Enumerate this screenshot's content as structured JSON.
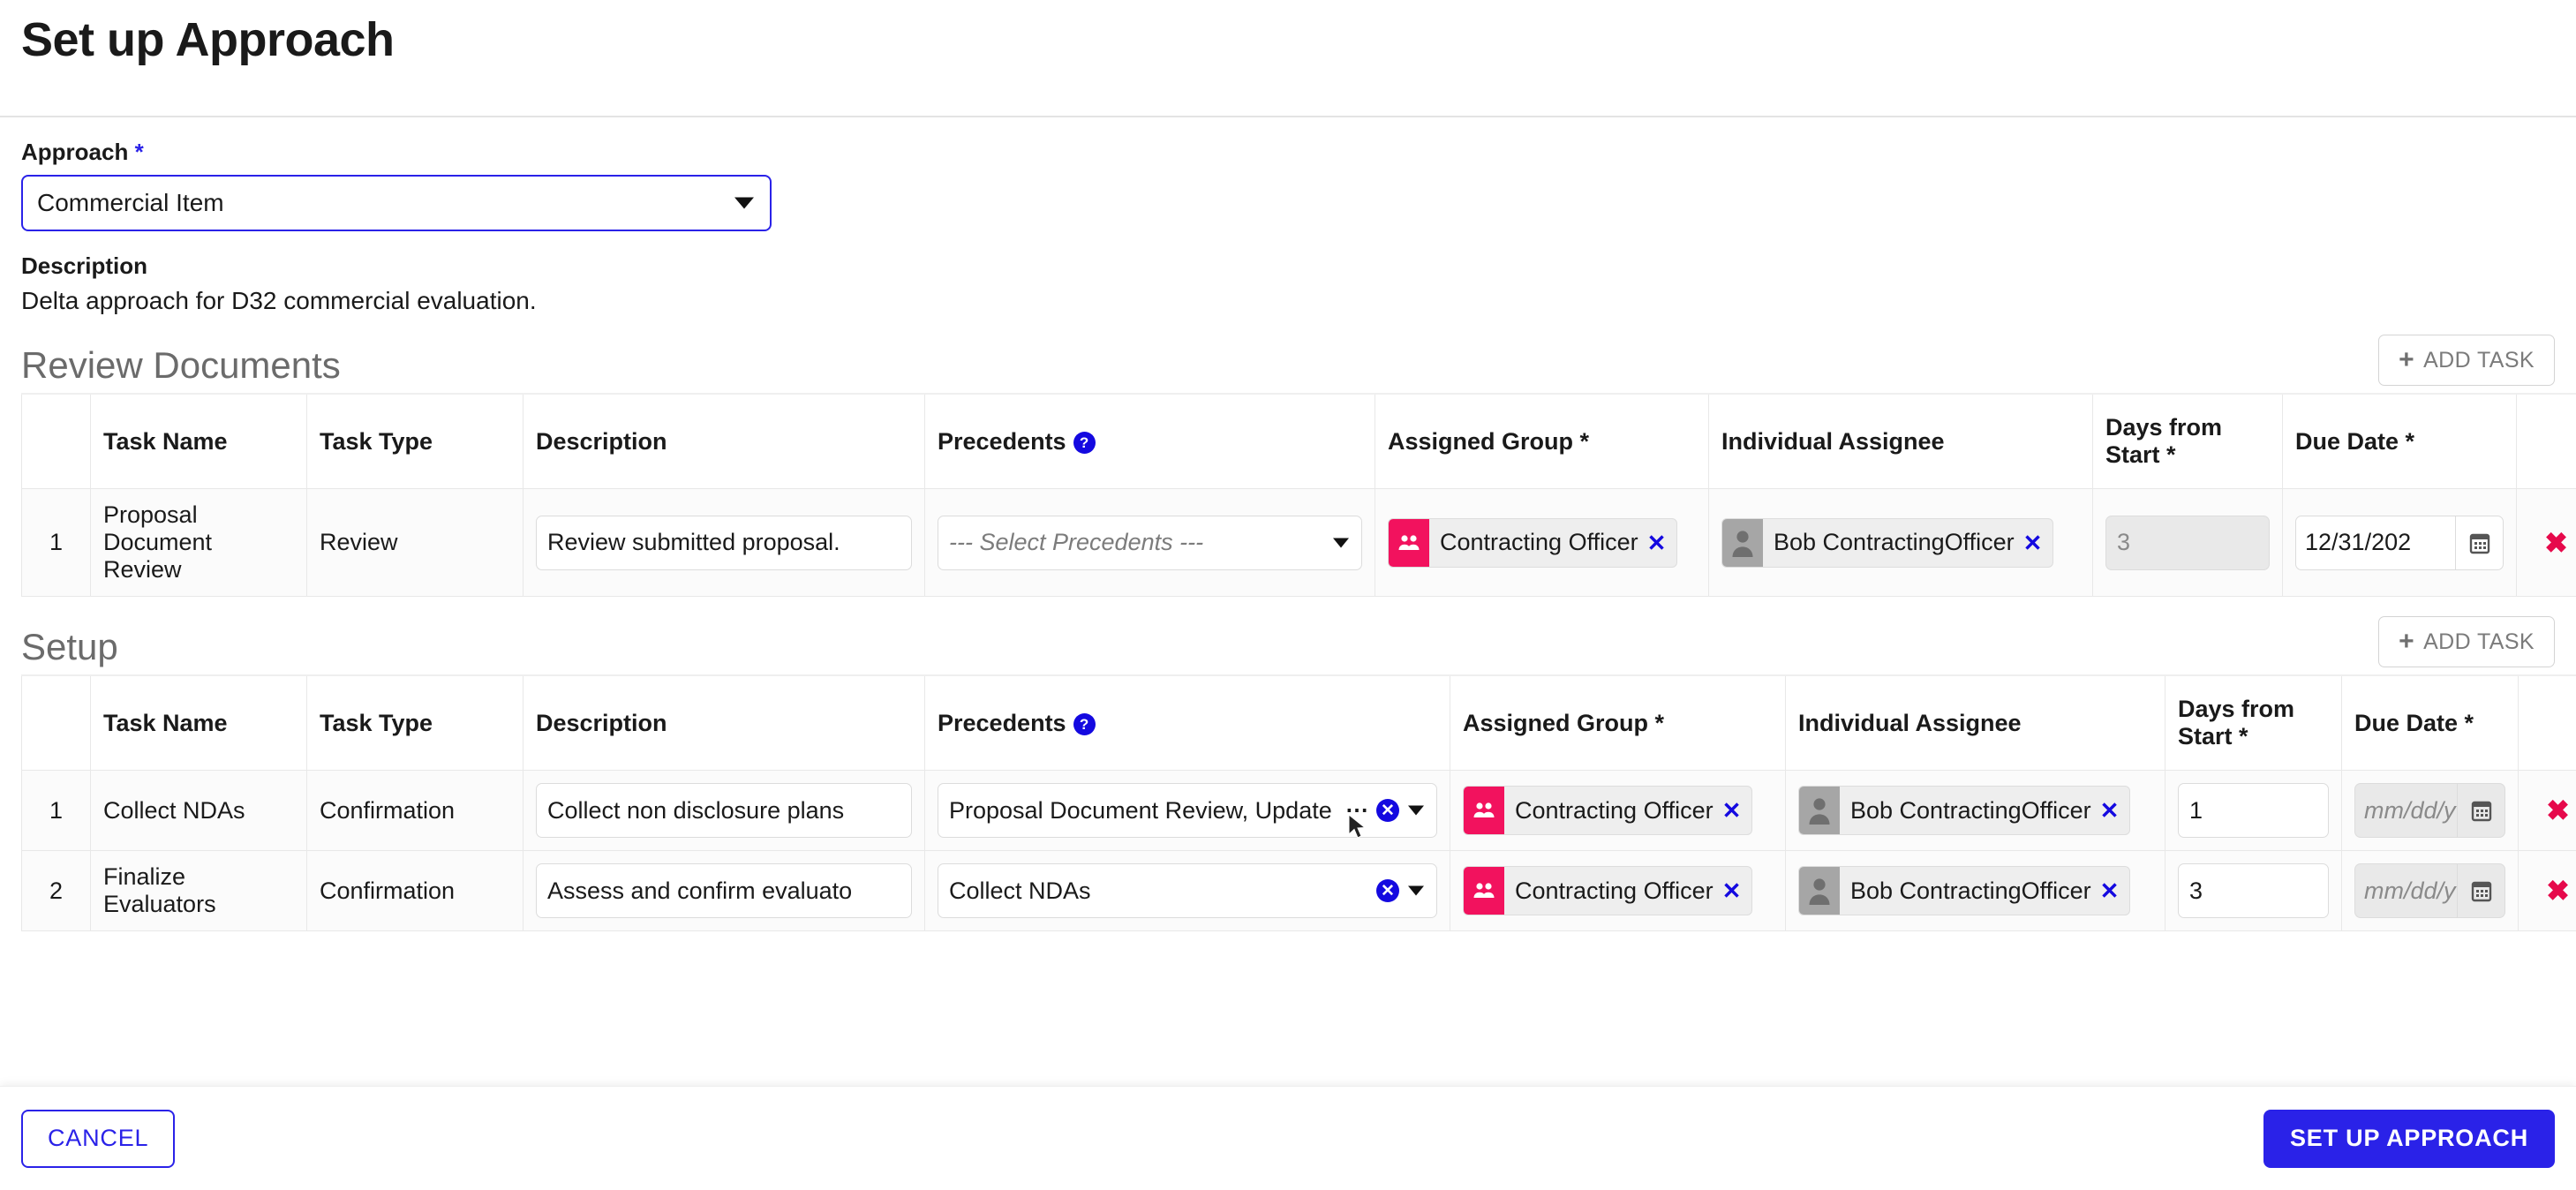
{
  "header": {
    "title": "Set up Approach"
  },
  "approach": {
    "label": "Approach",
    "required_mark": "*",
    "selected": "Commercial Item",
    "description_label": "Description",
    "description_text": "Delta approach for D32 commercial evaluation."
  },
  "columns": {
    "task_name": "Task Name",
    "task_type": "Task Type",
    "description": "Description",
    "precedents": "Precedents",
    "precedents_help": "?",
    "assigned_group": "Assigned Group *",
    "individual_assignee": "Individual Assignee",
    "days_from_start": "Days from Start *",
    "due_date": "Due Date *"
  },
  "add_task_label": "ADD TASK",
  "add_task_icon": "+",
  "sections": [
    {
      "title": "Review Documents",
      "rows": [
        {
          "index": "1",
          "task_name": "Proposal Document Review",
          "task_type": "Review",
          "description": "Review submitted proposal.",
          "precedents_value": "",
          "precedents_placeholder": "--- Select Precedents ---",
          "precedents_has_clear": false,
          "precedents_has_ellipsis": false,
          "assigned_group": "Contracting Officer",
          "individual_assignee": "Bob ContractingOfficer",
          "days_from_start": "3",
          "days_disabled": true,
          "due_date": "12/31/202",
          "due_date_placeholder": "",
          "due_date_disabled": false,
          "remove_label": "✖"
        }
      ]
    },
    {
      "title": "Setup",
      "rows": [
        {
          "index": "1",
          "task_name": "Collect NDAs",
          "task_type": "Confirmation",
          "description": "Collect non disclosure plans",
          "precedents_value": "Proposal Document Review, Update",
          "precedents_placeholder": "",
          "precedents_has_clear": true,
          "precedents_has_ellipsis": true,
          "assigned_group": "Contracting Officer",
          "individual_assignee": "Bob ContractingOfficer",
          "days_from_start": "1",
          "days_disabled": false,
          "due_date": "",
          "due_date_placeholder": "mm/dd/y",
          "due_date_disabled": true,
          "remove_label": "✖"
        },
        {
          "index": "2",
          "task_name": "Finalize Evaluators",
          "task_type": "Confirmation",
          "description": "Assess and confirm evaluato",
          "precedents_value": "Collect NDAs",
          "precedents_placeholder": "",
          "precedents_has_clear": true,
          "precedents_has_ellipsis": false,
          "assigned_group": "Contracting Officer",
          "individual_assignee": "Bob ContractingOfficer",
          "days_from_start": "3",
          "days_disabled": false,
          "due_date": "",
          "due_date_placeholder": "mm/dd/y",
          "due_date_disabled": true,
          "remove_label": "✖"
        }
      ]
    }
  ],
  "footer": {
    "cancel_label": "CANCEL",
    "submit_label": "SET UP APPROACH"
  },
  "colors": {
    "accent_blue": "#2a22e8",
    "group_chip": "#f2125e",
    "delete_red": "#e6094b",
    "section_gray": "#6b6b6b"
  }
}
